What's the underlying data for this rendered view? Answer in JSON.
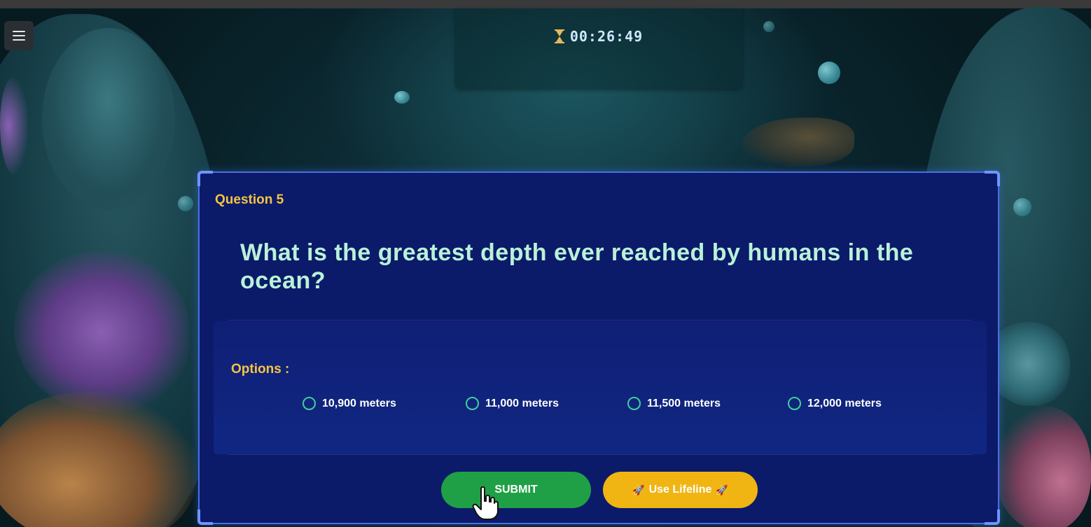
{
  "timer": {
    "icon": "hourglass-icon",
    "value": "00:26:49"
  },
  "menu": {
    "icon": "hamburger-menu-icon"
  },
  "question": {
    "label": "Question 5",
    "text": "What is the greatest depth ever reached by humans in the ocean?"
  },
  "options": {
    "label": "Options :",
    "items": [
      {
        "text": "10,900 meters"
      },
      {
        "text": "11,000 meters"
      },
      {
        "text": "11,500 meters"
      },
      {
        "text": "12,000 meters"
      }
    ]
  },
  "actions": {
    "submit_label": "SUBMIT",
    "lifeline_label": "Use Lifeline",
    "lifeline_icon": "rocket-icon"
  },
  "colors": {
    "accent_yellow": "#f5c542",
    "question_text": "#b8f2d8",
    "card_bg": "#0c1a6a",
    "submit_green": "#1fa047",
    "lifeline_yellow": "#f0b512",
    "radio_green": "#3fd19a"
  }
}
